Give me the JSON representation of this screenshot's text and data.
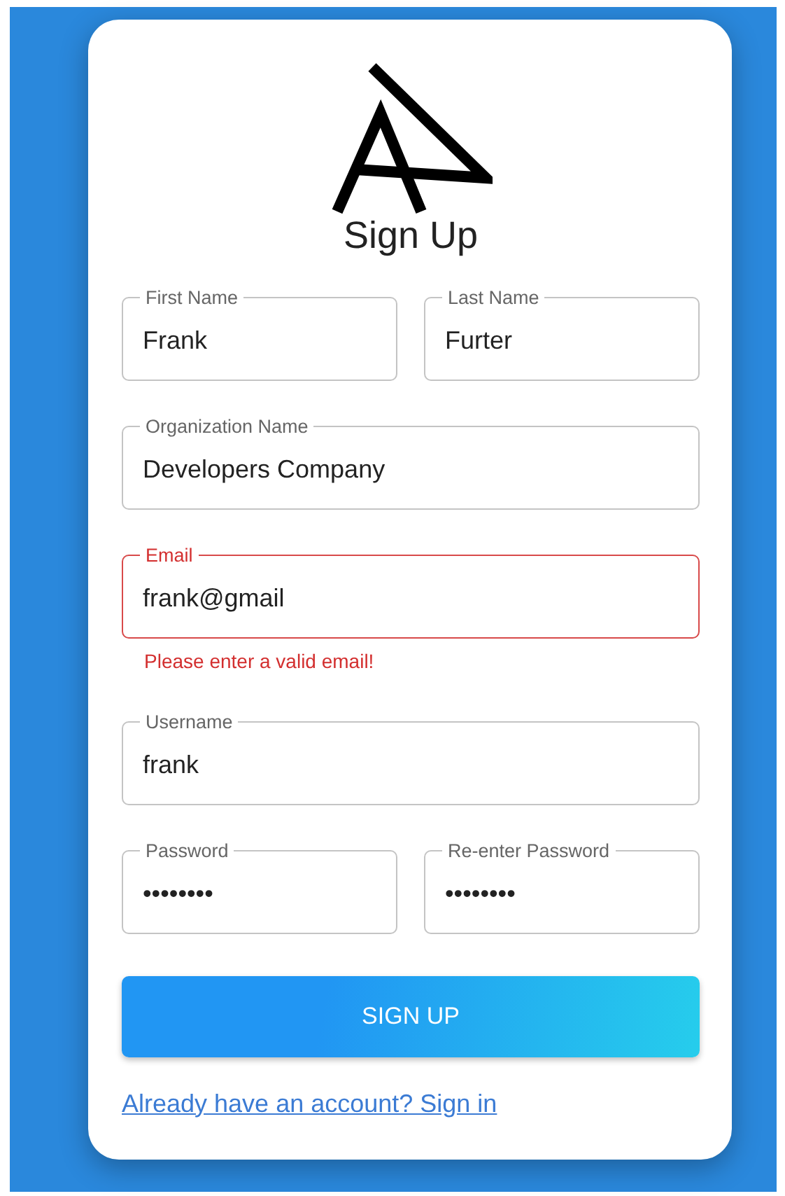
{
  "title": "Sign Up",
  "rows": [
    [
      {
        "label": "First Name",
        "value": "Frank",
        "error": false
      },
      {
        "label": "Last Name",
        "value": "Furter",
        "error": false
      }
    ],
    [
      {
        "label": "Organization Name",
        "value": "Developers Company",
        "error": false
      }
    ],
    [
      {
        "label": "Email",
        "value": "frank@gmail",
        "error": true,
        "helper": "Please enter a valid email!"
      }
    ],
    [
      {
        "label": "Username",
        "value": "frank",
        "error": false
      }
    ],
    [
      {
        "label": "Password",
        "value": "••••••••",
        "error": false
      },
      {
        "label": "Re-enter Password",
        "value": "••••••••",
        "error": false
      }
    ]
  ],
  "submit": "SIGN UP",
  "link": "Already have an account? Sign in"
}
